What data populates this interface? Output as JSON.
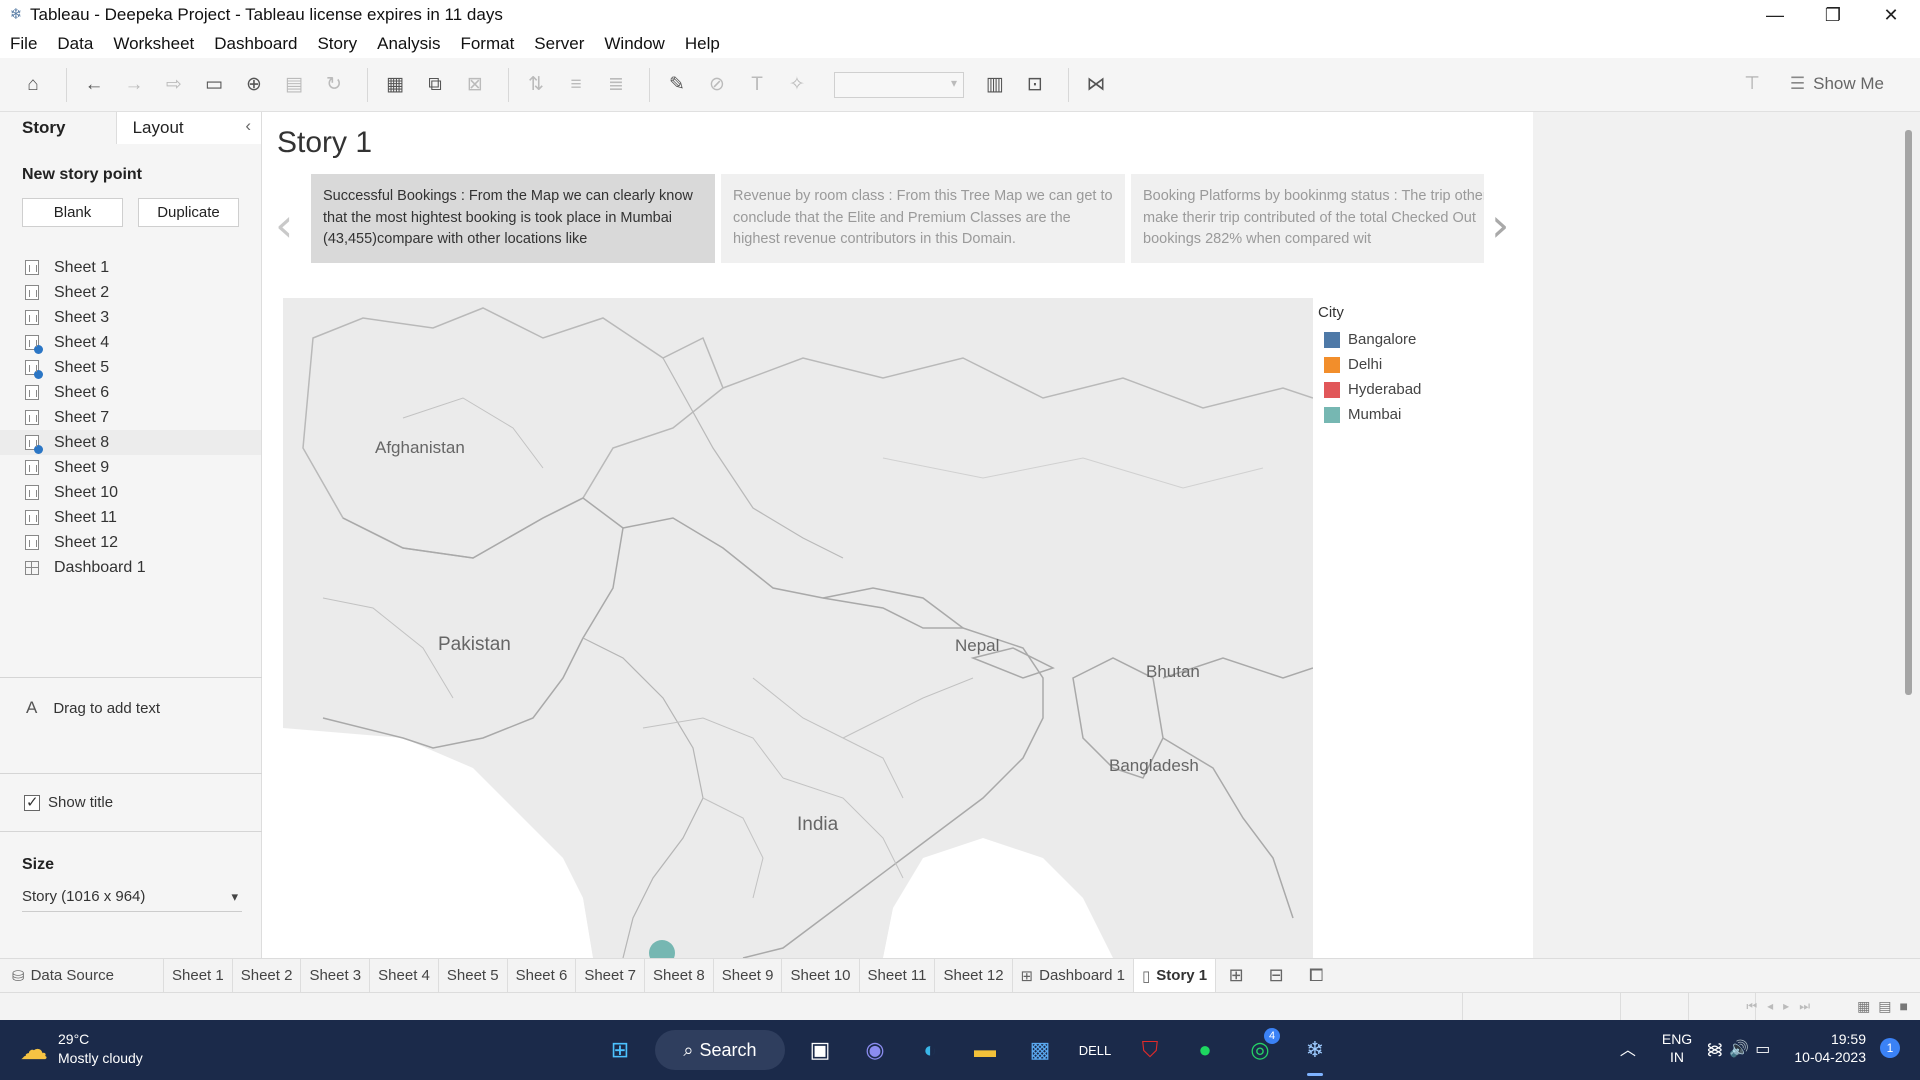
{
  "window": {
    "title": "Tableau - Deepeka Project - Tableau license expires in 11 days",
    "minimize_icon": "minimize-icon",
    "restore_icon": "restore-icon",
    "close_icon": "close-icon"
  },
  "menu": [
    "File",
    "Data",
    "Worksheet",
    "Dashboard",
    "Story",
    "Analysis",
    "Format",
    "Server",
    "Window",
    "Help"
  ],
  "toolbar": {
    "show_me_label": "Show Me"
  },
  "left_panel": {
    "tabs": [
      "Story",
      "Layout"
    ],
    "new_story_point_label": "New story point",
    "blank_button": "Blank",
    "duplicate_button": "Duplicate",
    "sheets": [
      {
        "label": "Sheet 1",
        "used": false
      },
      {
        "label": "Sheet 2",
        "used": false
      },
      {
        "label": "Sheet 3",
        "used": false
      },
      {
        "label": "Sheet 4",
        "used": true
      },
      {
        "label": "Sheet 5",
        "used": true
      },
      {
        "label": "Sheet 6",
        "used": false
      },
      {
        "label": "Sheet 7",
        "used": false
      },
      {
        "label": "Sheet 8",
        "used": true
      },
      {
        "label": "Sheet 9",
        "used": false
      },
      {
        "label": "Sheet 10",
        "used": false
      },
      {
        "label": "Sheet 11",
        "used": false
      },
      {
        "label": "Sheet 12",
        "used": false
      }
    ],
    "dashboard_item": "Dashboard 1",
    "drag_text": "Drag to add text",
    "show_title_label": "Show title",
    "show_title_checked": true,
    "size_label": "Size",
    "size_value": "Story (1016 x 964)"
  },
  "story": {
    "title": "Story 1",
    "points": [
      {
        "text": "Successful Bookings : From the Map we can clearly know that the most hightest booking is took place in Mumbai (43,455)compare with other locations like",
        "active": true
      },
      {
        "text": "Revenue by room class : From this Tree Map we can get to conclude that the Elite and Premium Classes are the highest revenue contributors in this Domain.",
        "active": false
      },
      {
        "text": "Booking Platforms by bookinmg status : The trip others make therir trip contributed of the total Checked Out bookings 282% when compared wit",
        "active": false
      }
    ]
  },
  "map": {
    "labels": {
      "afghanistan": "Afghanistan",
      "pakistan": "Pakistan",
      "nepal": "Nepal",
      "bhutan": "Bhutan",
      "bangladesh": "Bangladesh",
      "india": "India"
    },
    "highlighted_city": "Mumbai",
    "highlight_color": "#76b7b2"
  },
  "legend": {
    "title": "City",
    "items": [
      {
        "label": "Bangalore",
        "color": "#4e79a7"
      },
      {
        "label": "Delhi",
        "color": "#f28e2b"
      },
      {
        "label": "Hyderabad",
        "color": "#e15759"
      },
      {
        "label": "Mumbai",
        "color": "#76b7b2"
      }
    ]
  },
  "bottom_tabs": {
    "data_source": "Data Source",
    "sheets": [
      "Sheet 1",
      "Sheet 2",
      "Sheet 3",
      "Sheet 4",
      "Sheet 5",
      "Sheet 6",
      "Sheet 7",
      "Sheet 8",
      "Sheet 9",
      "Sheet 10",
      "Sheet 11",
      "Sheet 12"
    ],
    "dashboard": "Dashboard 1",
    "story": "Story 1"
  },
  "taskbar": {
    "weather_temp": "29°C",
    "weather_desc": "Mostly cloudy",
    "search_label": "Search",
    "whatsapp_badge": "4",
    "lang_line1": "ENG",
    "lang_line2": "IN",
    "time": "19:59",
    "date": "10-04-2023",
    "notification_count": "1"
  }
}
